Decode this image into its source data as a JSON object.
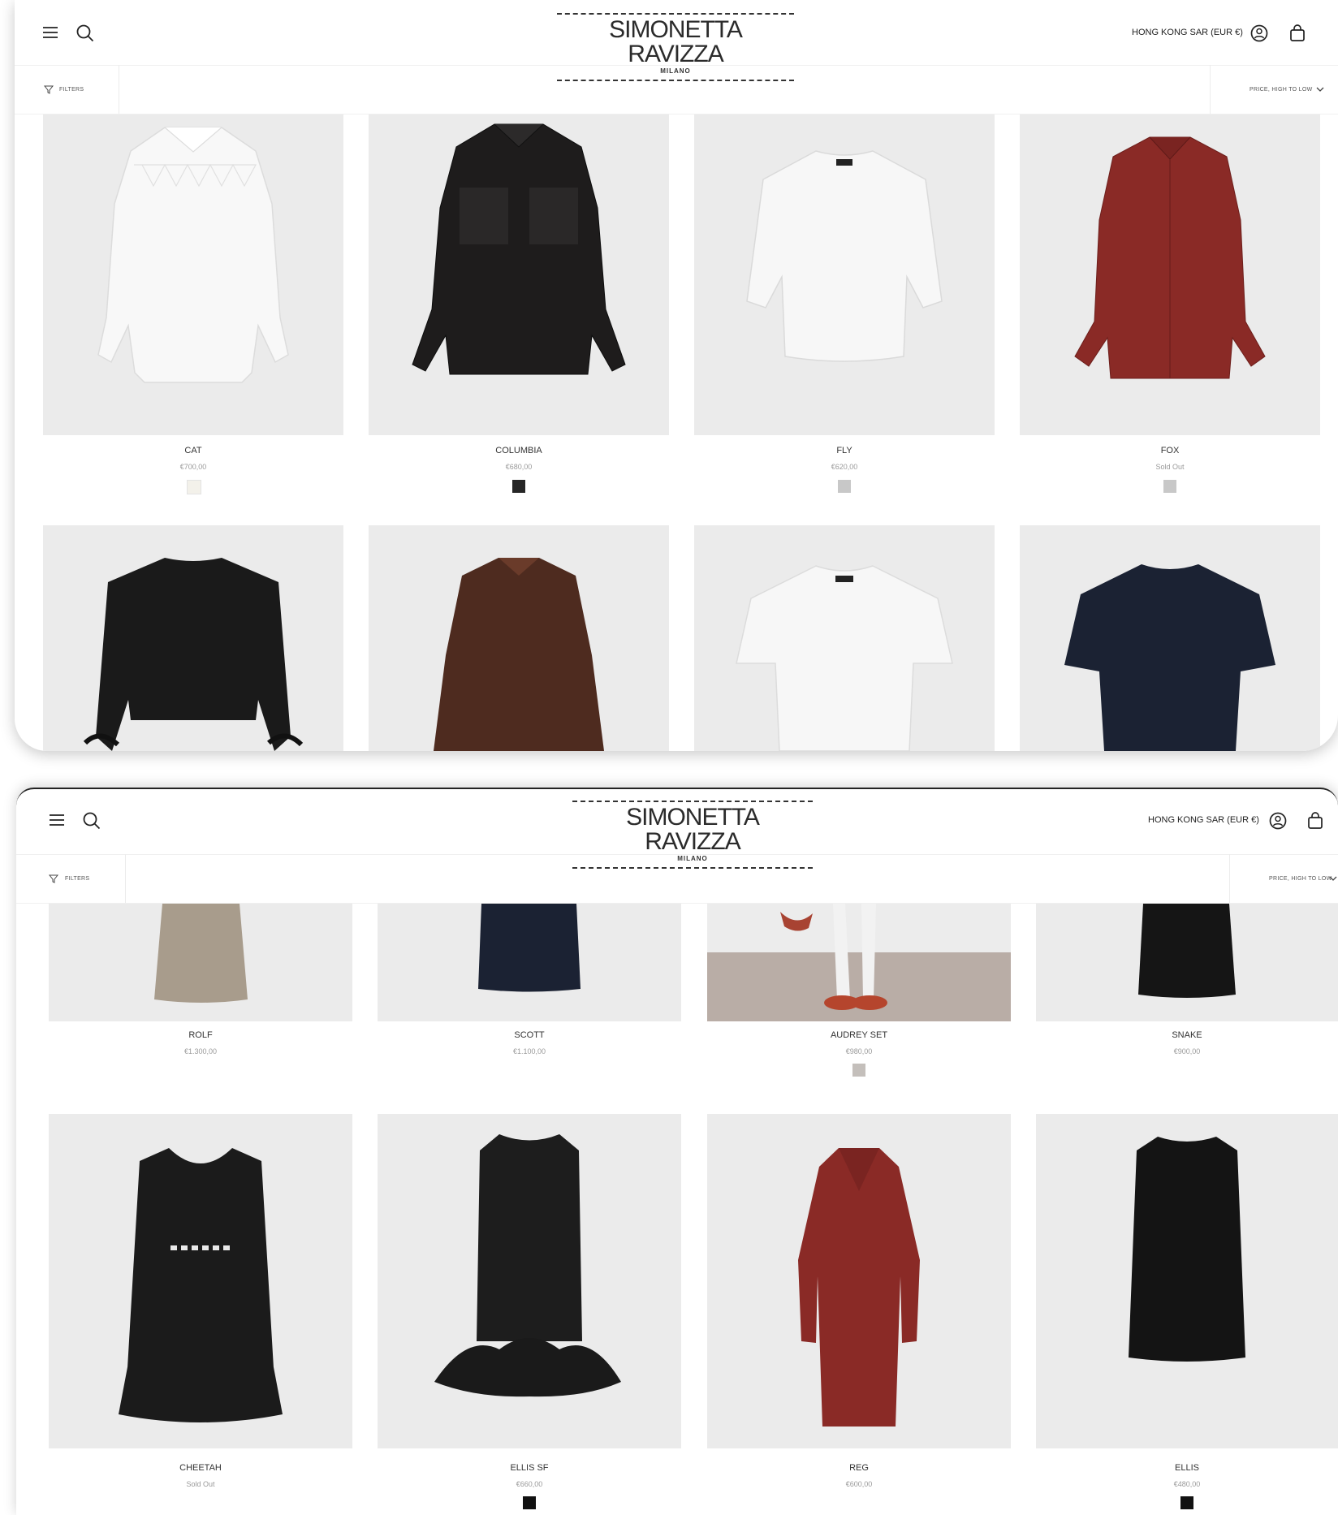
{
  "screens": [
    {
      "brand": {
        "name": "SIMONETTA RAVIZZA",
        "city": "MILANO"
      },
      "country_selector": "HONG KONG SAR (EUR €)",
      "filters_label": "FILTERS",
      "sort_label": "PRICE, HIGH TO LOW",
      "products": [
        {
          "name": "CAT",
          "price": "€700,00",
          "swatch": "#f3f1ea"
        },
        {
          "name": "COLUMBIA",
          "price": "€680,00",
          "swatch": "#262626"
        },
        {
          "name": "FLY",
          "price": "€620,00",
          "swatch": "#c8c8c8"
        },
        {
          "name": "FOX",
          "price": "Sold Out",
          "swatch": "#c8c8c8"
        },
        {
          "name": "",
          "price": ""
        },
        {
          "name": "",
          "price": ""
        },
        {
          "name": "",
          "price": ""
        },
        {
          "name": "",
          "price": ""
        }
      ]
    },
    {
      "brand": {
        "name": "SIMONETTA RAVIZZA",
        "city": "MILANO"
      },
      "country_selector": "HONG KONG SAR (EUR €)",
      "filters_label": "FILTERS",
      "sort_label": "PRICE, HIGH TO LOW",
      "products": [
        {
          "name": "ROLF",
          "price": "€1.300,00"
        },
        {
          "name": "SCOTT",
          "price": "€1.100,00"
        },
        {
          "name": "AUDREY SET",
          "price": "€980,00",
          "swatch": "#c4bfbb"
        },
        {
          "name": "SNAKE",
          "price": "€900,00"
        },
        {
          "name": "CHEETAH",
          "price": "Sold Out"
        },
        {
          "name": "ELLIS SF",
          "price": "€660,00",
          "swatch": "#111111"
        },
        {
          "name": "REG",
          "price": "€600,00"
        },
        {
          "name": "ELLIS",
          "price": "€480,00",
          "swatch": "#111111"
        }
      ]
    }
  ],
  "colors": {
    "image_bg": "#ebebeb",
    "text_muted": "#9a9a9a",
    "red_garment": "#8a2a26",
    "brown_garment": "#4e2b1f",
    "navy_garment": "#1b2233"
  },
  "icons": [
    "menu-icon",
    "search-icon",
    "account-icon",
    "cart-icon",
    "filter-icon",
    "chevron-down-icon"
  ]
}
